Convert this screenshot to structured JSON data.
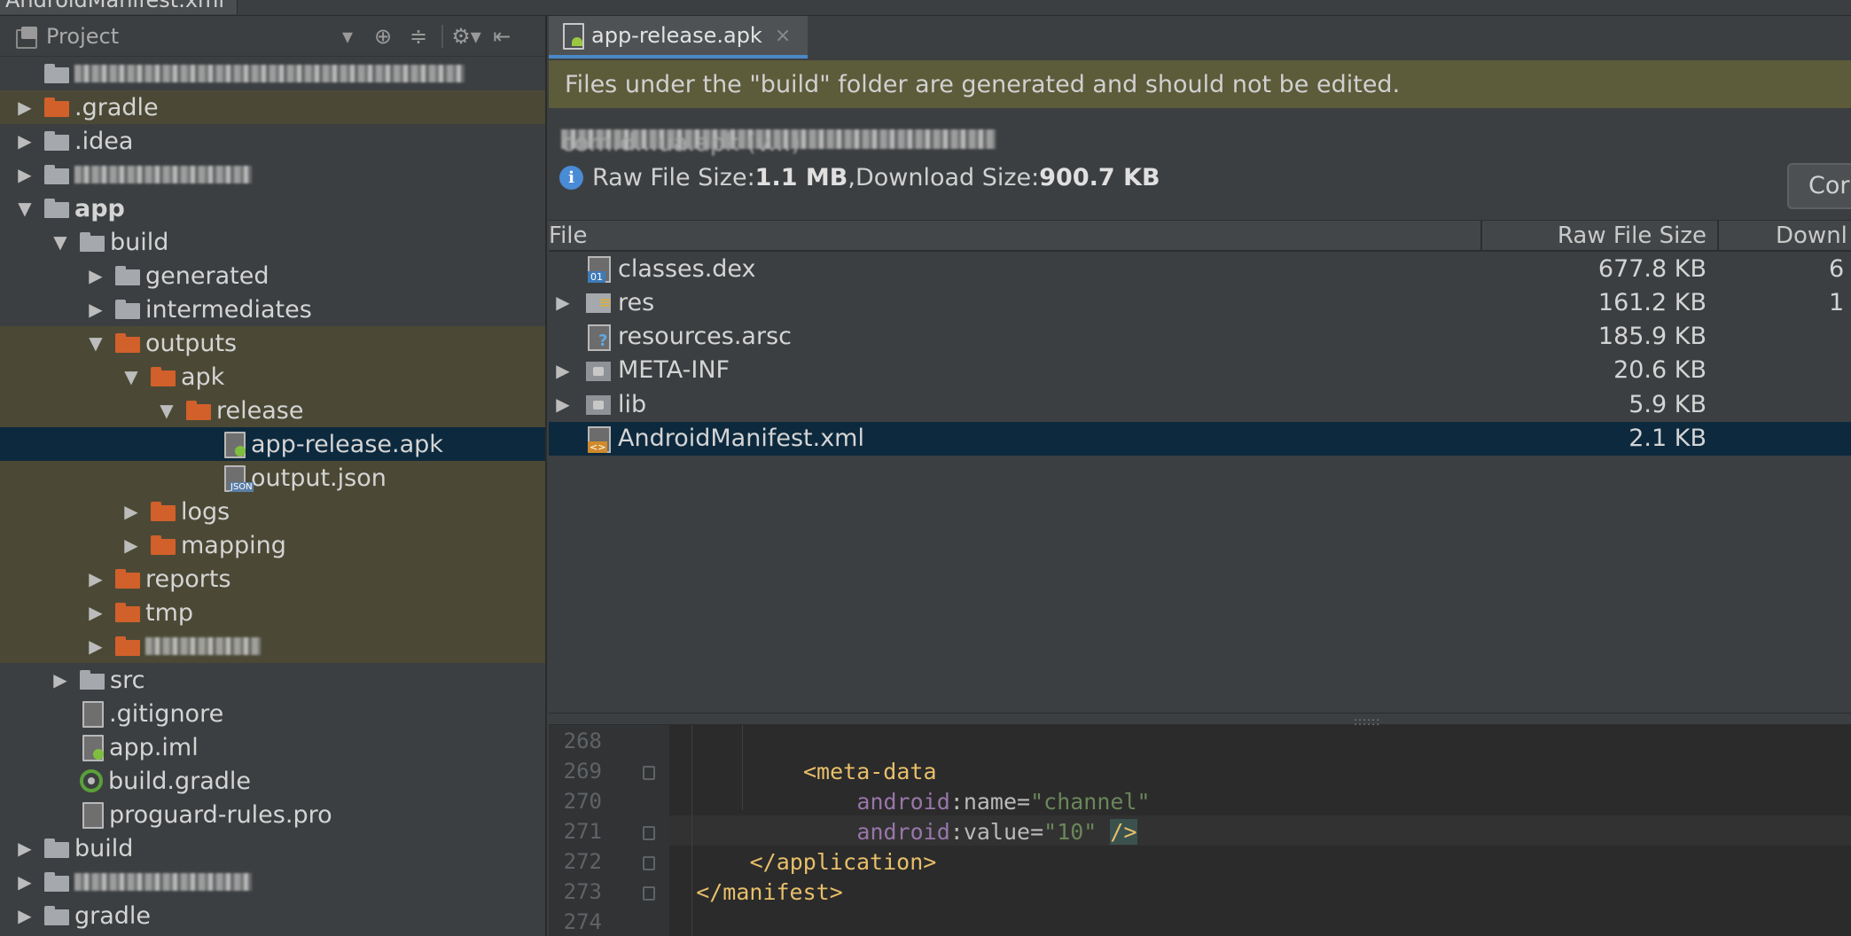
{
  "window": {
    "top_tab_label": "AndroidManifest.xml"
  },
  "project_panel": {
    "title": "Project",
    "header_buttons": [
      "⊕",
      "≑",
      "⚙▾",
      "⇤"
    ],
    "tree": [
      {
        "label": "",
        "blurred": true,
        "blur_width": 440,
        "indent": 0,
        "arrow": "none",
        "icon": "project-root",
        "row_style": ""
      },
      {
        "label": ".gradle",
        "indent": 0,
        "arrow": "collapsed",
        "icon": "folder-orange",
        "row_style": "tinted"
      },
      {
        "label": ".idea",
        "indent": 0,
        "arrow": "collapsed",
        "icon": "folder-grey",
        "row_style": ""
      },
      {
        "label": "",
        "blurred": true,
        "blur_width": 200,
        "indent": 0,
        "arrow": "collapsed",
        "icon": "folder-grey",
        "row_style": ""
      },
      {
        "label": "app",
        "indent": 0,
        "arrow": "expanded",
        "icon": "folder-module",
        "row_style": ""
      },
      {
        "label": "build",
        "indent": 1,
        "arrow": "expanded",
        "icon": "folder-grey",
        "row_style": ""
      },
      {
        "label": "generated",
        "indent": 2,
        "arrow": "collapsed",
        "icon": "folder-grey",
        "row_style": ""
      },
      {
        "label": "intermediates",
        "indent": 2,
        "arrow": "collapsed",
        "icon": "folder-grey",
        "row_style": ""
      },
      {
        "label": "outputs",
        "indent": 2,
        "arrow": "expanded",
        "icon": "folder-orange",
        "row_style": "tinted"
      },
      {
        "label": "apk",
        "indent": 3,
        "arrow": "expanded",
        "icon": "folder-orange",
        "row_style": "tinted"
      },
      {
        "label": "release",
        "indent": 4,
        "arrow": "expanded",
        "icon": "folder-orange",
        "row_style": "tinted"
      },
      {
        "label": "app-release.apk",
        "indent": 5,
        "arrow": "none",
        "icon": "file-apk",
        "row_style": "selected"
      },
      {
        "label": "output.json",
        "indent": 5,
        "arrow": "none",
        "icon": "file-json",
        "row_style": "tinted"
      },
      {
        "label": "logs",
        "indent": 3,
        "arrow": "collapsed",
        "icon": "folder-orange",
        "row_style": "tinted"
      },
      {
        "label": "mapping",
        "indent": 3,
        "arrow": "collapsed",
        "icon": "folder-orange",
        "row_style": "tinted"
      },
      {
        "label": "reports",
        "indent": 2,
        "arrow": "collapsed",
        "icon": "folder-orange",
        "row_style": "tinted"
      },
      {
        "label": "tmp",
        "indent": 2,
        "arrow": "collapsed",
        "icon": "folder-orange",
        "row_style": "tinted"
      },
      {
        "label": "",
        "blurred": true,
        "blur_width": 130,
        "indent": 2,
        "arrow": "collapsed",
        "icon": "folder-orange",
        "row_style": "tinted"
      },
      {
        "label": "src",
        "indent": 1,
        "arrow": "collapsed",
        "icon": "folder-grey",
        "row_style": ""
      },
      {
        "label": ".gitignore",
        "indent": 1,
        "arrow": "none",
        "icon": "file-text",
        "row_style": ""
      },
      {
        "label": "app.iml",
        "indent": 1,
        "arrow": "none",
        "icon": "file-iml",
        "row_style": ""
      },
      {
        "label": "build.gradle",
        "indent": 1,
        "arrow": "none",
        "icon": "gradle",
        "row_style": ""
      },
      {
        "label": "proguard-rules.pro",
        "indent": 1,
        "arrow": "none",
        "icon": "file-text",
        "row_style": ""
      },
      {
        "label": "build",
        "indent": 0,
        "arrow": "collapsed",
        "icon": "folder-grey",
        "row_style": ""
      },
      {
        "label": "",
        "blurred": true,
        "blur_width": 200,
        "indent": 0,
        "arrow": "collapsed",
        "icon": "folder-grey",
        "row_style": ""
      },
      {
        "label": "gradle",
        "indent": 0,
        "arrow": "collapsed",
        "icon": "folder-grey",
        "row_style": ""
      }
    ]
  },
  "editor_tab": {
    "label": "app-release.apk",
    "close": "×"
  },
  "banner": {
    "text": "Files under the \"build\" folder are generated and should not be edited."
  },
  "apk_info": {
    "apk_name": "com.d...ua.apk (v...)",
    "raw_label": "Raw File Size: ",
    "raw_value": "1.1 MB",
    "sep": ", ",
    "download_label": "Download Size: ",
    "download_value": "900.7 KB",
    "info_icon": "i",
    "compare_button": "Cor"
  },
  "table": {
    "headers": {
      "file": "File",
      "raw": "Raw File Size",
      "download": "Downl"
    },
    "rows": [
      {
        "name": "classes.dex",
        "raw": "677.8 KB",
        "download": "6",
        "icon": "dex",
        "arrow": "none",
        "selected": false
      },
      {
        "name": "res",
        "raw": "161.2 KB",
        "download": "1",
        "icon": "folder-res",
        "arrow": "collapsed",
        "selected": false
      },
      {
        "name": "resources.arsc",
        "raw": "185.9 KB",
        "download": "",
        "icon": "arsc",
        "arrow": "none",
        "selected": false
      },
      {
        "name": "META-INF",
        "raw": "20.6 KB",
        "download": "",
        "icon": "folder-plain",
        "arrow": "collapsed",
        "selected": false
      },
      {
        "name": "lib",
        "raw": "5.9 KB",
        "download": "",
        "icon": "folder-plain",
        "arrow": "collapsed",
        "selected": false
      },
      {
        "name": "AndroidManifest.xml",
        "raw": "2.1 KB",
        "download": "",
        "icon": "xml",
        "arrow": "none",
        "selected": true
      }
    ]
  },
  "code_editor": {
    "lines": [
      {
        "num": "268"
      },
      {
        "num": "269",
        "tag_open": "<meta-data"
      },
      {
        "num": "270",
        "ns": "android",
        "colon": ":",
        "attr": "name",
        "eq": "=",
        "value": "\"channel\""
      },
      {
        "num": "271",
        "ns": "android",
        "colon": ":",
        "attr": "value",
        "eq": "=",
        "value": "\"10\"",
        "close": "/>"
      },
      {
        "num": "272",
        "tag_close": "</application>"
      },
      {
        "num": "273",
        "tag_close": "</manifest>"
      },
      {
        "num": "274"
      }
    ]
  }
}
